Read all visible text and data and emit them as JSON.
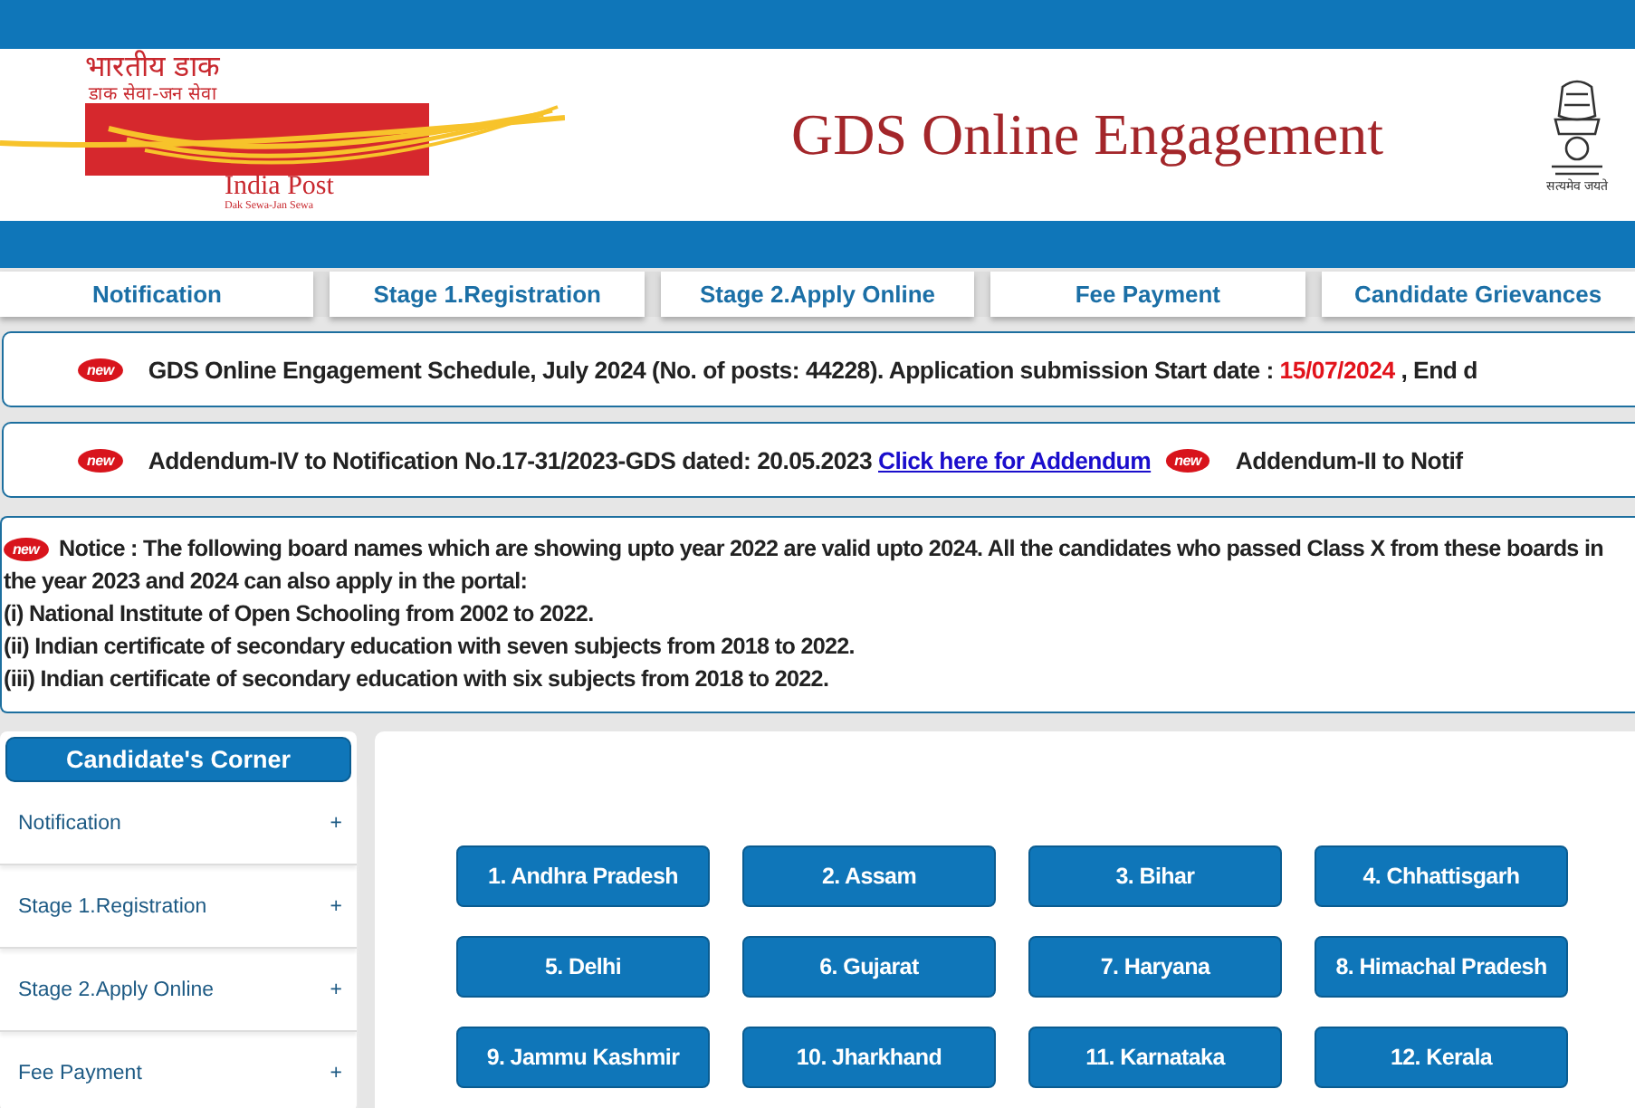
{
  "header": {
    "logo_hindi": "भारतीय डाक",
    "logo_hindi_tagline": "डाक सेवा-जन सेवा",
    "logo_name": "India Post",
    "logo_tagline": "Dak Sewa-Jan Sewa",
    "title": "GDS Online Engagement",
    "emblem_caption": "सत्यमेव जयते"
  },
  "nav": [
    {
      "label": "Notification",
      "selected": false
    },
    {
      "label": "Stage 1.Registration",
      "selected": false
    },
    {
      "label": "Stage 2.Apply Online",
      "selected": false
    },
    {
      "label": "Fee Payment",
      "selected": false
    },
    {
      "label": "Candidate Grievances",
      "selected": false
    }
  ],
  "tickers": [
    [
      {
        "kind": "badge",
        "text": "new"
      },
      {
        "kind": "plain",
        "text": "GDS Online Engagement Schedule, July 2024 (No. of posts: 44228). Application submission Start date : "
      },
      {
        "kind": "date",
        "text": "15/07/2024"
      },
      {
        "kind": "plain",
        "text": " , End d"
      }
    ],
    [
      {
        "kind": "badge",
        "text": "new"
      },
      {
        "kind": "plain",
        "text": "Addendum-IV to Notification No.17-31/2023-GDS dated: 20.05.2023 "
      },
      {
        "kind": "link",
        "text": "Click here for Addendum"
      },
      {
        "kind": "badge",
        "text": "new"
      },
      {
        "kind": "plain",
        "text": "Addendum-II to Notif"
      }
    ]
  ],
  "notice": {
    "badge": "new",
    "text": "Notice : The following board names which are showing upto year 2022 are valid upto 2024. All the candidates who passed Class X from these boards in the year 2023 and 2024 can also apply in the portal:",
    "lines": [
      "(i) National Institute of Open Schooling from 2002 to 2022.",
      "(ii) Indian certificate of secondary education with seven subjects from 2018 to 2022.",
      "(iii) Indian certificate of secondary education with six subjects from 2018 to 2022."
    ]
  },
  "sidebar": {
    "title": "Candidate's Corner",
    "items": [
      {
        "label": "Notification",
        "toggle": "+"
      },
      {
        "label": "Stage 1.Registration",
        "toggle": "+"
      },
      {
        "label": "Stage 2.Apply Online",
        "toggle": "+"
      },
      {
        "label": "Fee Payment",
        "toggle": "+"
      }
    ]
  },
  "states": [
    "1. Andhra Pradesh",
    "2. Assam",
    "3. Bihar",
    "4. Chhattisgarh",
    "5. Delhi",
    "6. Gujarat",
    "7. Haryana",
    "8. Himachal Pradesh",
    "9. Jammu Kashmir",
    "10. Jharkhand",
    "11. Karnataka",
    "12. Kerala"
  ]
}
